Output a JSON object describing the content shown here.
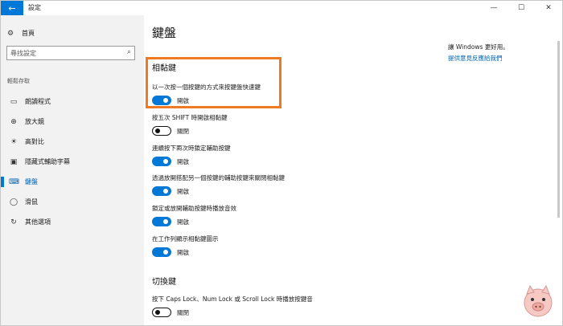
{
  "window": {
    "title": "設定",
    "back_icon": "←",
    "minimize_icon": "—",
    "maximize_icon": "☐",
    "close_icon": "✕"
  },
  "sidebar": {
    "home_icon": "⚙",
    "home_label": "首頁",
    "search_placeholder": "尋找設定",
    "search_icon": "⌕",
    "section_header": "輕鬆存取",
    "items": [
      {
        "icon": "▭",
        "icon_name": "narrator-icon",
        "label": "朗讀程式",
        "active": false
      },
      {
        "icon": "⊕",
        "icon_name": "magnifier-icon",
        "label": "放大鏡",
        "active": false
      },
      {
        "icon": "☀",
        "icon_name": "high-contrast-icon",
        "label": "高對比",
        "active": false
      },
      {
        "icon": "▣",
        "icon_name": "closed-captions-icon",
        "label": "隱藏式輔助字幕",
        "active": false
      },
      {
        "icon": "⌨",
        "icon_name": "keyboard-icon",
        "label": "鍵盤",
        "active": true
      },
      {
        "icon": "◯",
        "icon_name": "mouse-icon",
        "label": "滑鼠",
        "active": false
      },
      {
        "icon": "↻",
        "icon_name": "other-options-icon",
        "label": "其他選項",
        "active": false
      }
    ]
  },
  "main": {
    "page_title": "鍵盤",
    "side_note": "讓 Windows 更好用。",
    "side_link": "提供意見反應給我們",
    "sticky_keys_header": "相黏鍵",
    "toggle_keys_header": "切換鍵",
    "settings": [
      {
        "desc": "以一次按一個按鍵的方式來按鍵盤快速鍵",
        "on": true,
        "state": "開啟"
      },
      {
        "desc": "按五次 SHIFT 時開啟相黏鍵",
        "on": false,
        "state": "關閉"
      },
      {
        "desc": "連續按下兩次時鎖定輔助按鍵",
        "on": true,
        "state": "開啟"
      },
      {
        "desc": "透過放開搭配另一個按鍵的輔助按鍵來關閉相黏鍵",
        "on": true,
        "state": "開啟"
      },
      {
        "desc": "鎖定或放開輔助按鍵時播放音效",
        "on": true,
        "state": "開啟"
      },
      {
        "desc": "在工作列顯示相黏鍵圖示",
        "on": true,
        "state": "開啟"
      },
      {
        "desc": "按下 Caps Lock、Num Lock 或 Scroll Lock 時播放按鍵音",
        "on": false,
        "state": "關閉"
      }
    ]
  },
  "colors": {
    "accent": "#0078d7",
    "highlight_box": "#ee7b22"
  }
}
